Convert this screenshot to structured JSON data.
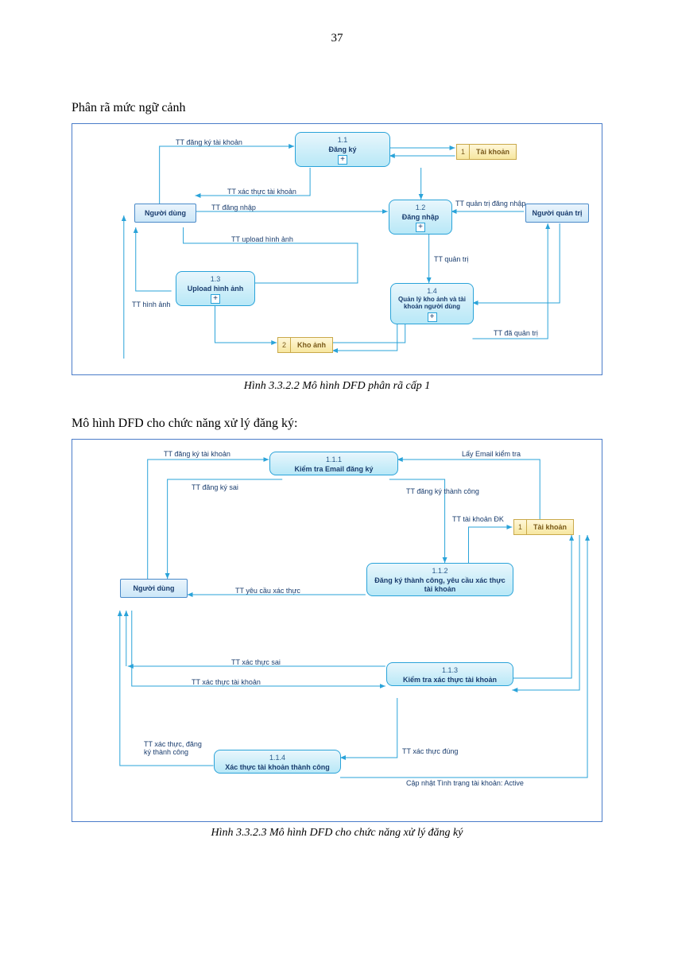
{
  "page_number": "37",
  "heading1": "Phân rã mức ngữ cảnh",
  "caption1": "Hình 3.3.2.2 Mô hình DFD phân rã cấp 1",
  "heading2": "Mô hình DFD cho chức năng xử lý đăng ký:",
  "caption2": "Hình 3.3.2.3 Mô hình DFD cho chức năng xử lý đăng ký",
  "d1": {
    "e1": "Người dùng",
    "e2": "Người quản trị",
    "p1_id": "1.1",
    "p1": "Đăng ký",
    "p2_id": "1.2",
    "p2": "Đăng nhập",
    "p3_id": "1.3",
    "p3": "Upload hình ảnh",
    "p4_id": "1.4",
    "p4": "Quản lý kho ảnh và tài khoản người dùng",
    "s1_id": "1",
    "s1": "Tài khoản",
    "s2_id": "2",
    "s2": "Kho ảnh",
    "l_reg": "TT đăng ký tài khoản",
    "l_auth": "TT xác thực tài khoản",
    "l_login": "TT đăng nhập",
    "l_upload": "TT upload hình ảnh",
    "l_img": "TT hình ảnh",
    "l_admin_login": "TT quản trị đăng nhập",
    "l_admin": "TT quản trị",
    "l_done_admin": "TT đã quản trị"
  },
  "d2": {
    "e1": "Người dùng",
    "p1_id": "1.1.1",
    "p1": "Kiểm tra Email đăng ký",
    "p2_id": "1.1.2",
    "p2": "Đăng ký thành công, yêu cầu xác  thực tài khoản",
    "p3_id": "1.1.3",
    "p3": "Kiểm tra xác thực tài khoản",
    "p4_id": "1.1.4",
    "p4": "Xác thực tài khoản thành công",
    "s1_id": "1",
    "s1": "Tài khoản",
    "l_reg": "TT đăng ký tài khoản",
    "l_reg_fail": "TT đăng ký sai",
    "l_reg_ok": "TT đăng ký thành công",
    "l_check_email": "Lấy Email kiểm tra",
    "l_acct_reg": "TT tài khoản ĐK",
    "l_req_auth": "TT yêu cầu xác thực",
    "l_auth_fail": "TT xác thực sai",
    "l_auth_acct": "TT xác thực tài khoản",
    "l_auth_ok": "TT xác thực đúng",
    "l_auth_done": "TT xác thực, đăng ký thành công",
    "l_update": "Cập nhật Tình trạng tài khoản: Active"
  }
}
